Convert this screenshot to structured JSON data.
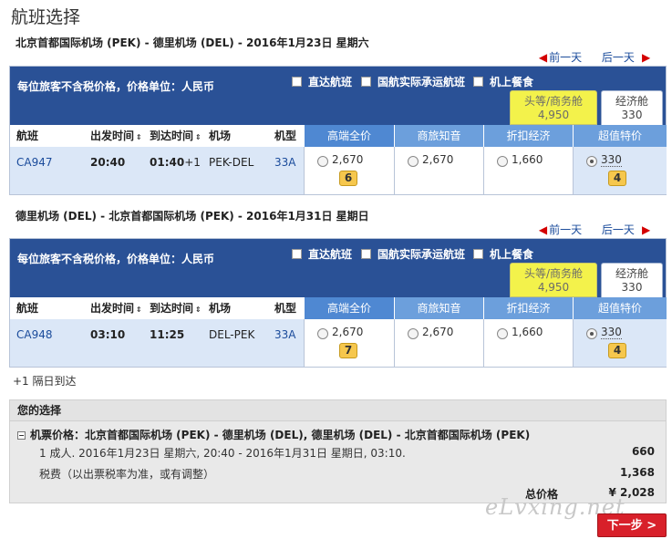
{
  "page_title": "航班选择",
  "nav": {
    "prev_day": "前一天",
    "next_day": "后一天",
    "prev_arrow": "◀",
    "next_arrow": "◀"
  },
  "panel_common": {
    "price_note": "每位旅客不含税价格，价格单位：人民币",
    "filters": [
      "直达航班",
      "国航实际承运航班",
      "机上餐食"
    ],
    "columns": {
      "flight": "航班",
      "depart": "出发时间",
      "arrive": "到达时间",
      "airports": "机场",
      "model": "机型",
      "sort_icon": "⇕"
    },
    "fare_classes": [
      "高端全价",
      "商旅知音",
      "折扣经济",
      "超值特价"
    ],
    "cabin_first_label": "头等/商务舱",
    "cabin_economy_label": "经济舱"
  },
  "outbound": {
    "route": "北京首都国际机场 (PEK) - 德里机场 (DEL) - 2016年1月23日 星期六",
    "cabin_first_price": "4,950",
    "cabin_economy_price": "330",
    "flight": "CA947",
    "depart": "20:40",
    "arrive": "01:40",
    "arrive_plus": "+1",
    "airports": "PEK-DEL",
    "model": "33A",
    "fares": [
      {
        "price": "2,670",
        "seats": "6",
        "selected": false
      },
      {
        "price": "2,670",
        "seats": "",
        "selected": false
      },
      {
        "price": "1,660",
        "seats": "",
        "selected": false
      },
      {
        "price": "330",
        "seats": "4",
        "selected": true
      }
    ]
  },
  "inbound": {
    "route": "德里机场 (DEL) - 北京首都国际机场 (PEK) - 2016年1月31日 星期日",
    "cabin_first_price": "4,950",
    "cabin_economy_price": "330",
    "flight": "CA948",
    "depart": "03:10",
    "arrive": "11:25",
    "airports": "DEL-PEK",
    "model": "33A",
    "fares": [
      {
        "price": "2,670",
        "seats": "7",
        "selected": false
      },
      {
        "price": "2,670",
        "seats": "",
        "selected": false
      },
      {
        "price": "1,660",
        "seats": "",
        "selected": false
      },
      {
        "price": "330",
        "seats": "4",
        "selected": true
      }
    ]
  },
  "next_day_note": "+1 隔日到达",
  "summary": {
    "title": "您的选择",
    "ticket_line": "机票价格：北京首都国际机场 (PEK) - 德里机场 (DEL), 德里机场 (DEL) - 北京首都国际机场 (PEK)",
    "passenger_line": "1 成人. 2016年1月23日 星期六, 20:40 - 2016年1月31日 星期日, 03:10.",
    "passenger_price": "660",
    "tax_line": "税费（以出票税率为准，或有调整）",
    "tax_price": "1,368",
    "total_label": "总价格",
    "total_price": "¥ 2,028",
    "collapse_icon": "−"
  },
  "watermark": "eLvxing.net",
  "next_button": "下一步 >"
}
